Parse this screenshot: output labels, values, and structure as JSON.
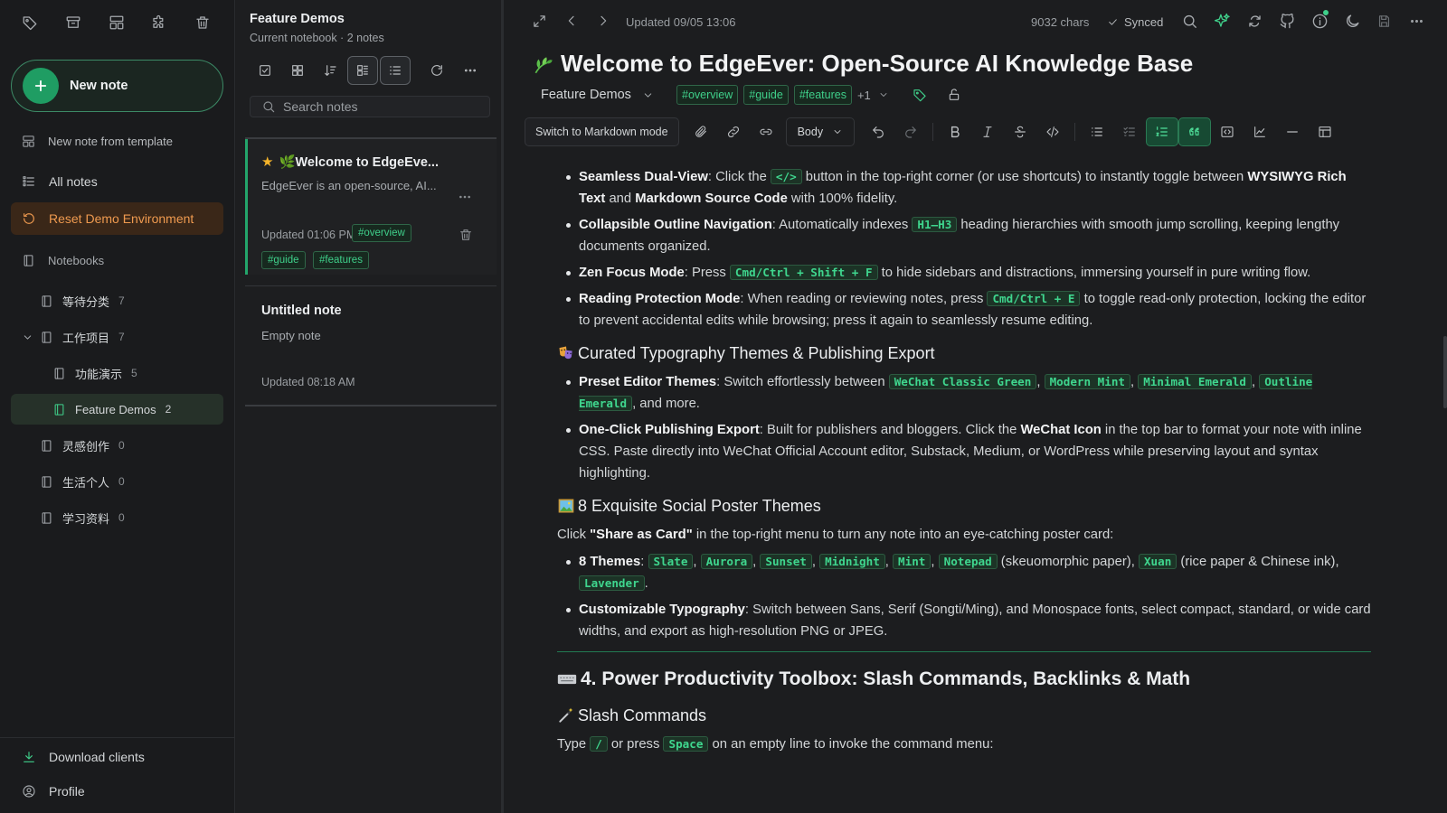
{
  "sidebar": {
    "new_note": "New note",
    "new_from_template": "New note from template",
    "all_notes": "All notes",
    "reset_demo": "Reset Demo Environment",
    "notebooks_label": "Notebooks",
    "notebooks": [
      {
        "name": "等待分类",
        "count": "7"
      },
      {
        "name": "工作项目",
        "count": "7"
      },
      {
        "name": "功能演示",
        "count": "5"
      },
      {
        "name": "Feature Demos",
        "count": "2"
      },
      {
        "name": "灵感创作",
        "count": "0"
      },
      {
        "name": "生活个人",
        "count": "0"
      },
      {
        "name": "学习资料",
        "count": "0"
      }
    ],
    "download_clients": "Download clients",
    "profile": "Profile"
  },
  "notelist": {
    "title": "Feature Demos",
    "subtitle": "Current notebook · 2 notes",
    "search_placeholder": "Search notes",
    "notes": [
      {
        "title": "🌿Welcome to EdgeEve...",
        "snippet": "EdgeEver is an open-source, AI...",
        "updated": "Updated 01:06 PM",
        "tags": [
          "#overview",
          "#guide",
          "#features"
        ],
        "starred": true
      },
      {
        "title": "Untitled note",
        "snippet": "Empty note",
        "updated": "Updated 08:18 AM",
        "tags": [],
        "starred": false
      }
    ]
  },
  "editor": {
    "updated": "Updated 09/05 13:06",
    "chars": "9032 chars",
    "synced": "Synced",
    "title": "Welcome to EdgeEver: Open-Source AI Knowledge Base",
    "notebook": "Feature Demos",
    "tags": [
      "#overview",
      "#guide",
      "#features"
    ],
    "tags_more": "+1",
    "markdown_mode": "Switch to Markdown mode",
    "text_style": "Body"
  },
  "content": {
    "b1_label": "Seamless Dual-View",
    "b1_a": ": Click the ",
    "b1_code": "</>",
    "b1_b": " button in the top-right corner (or use shortcuts) to instantly toggle between ",
    "b1_bold1": "WYSIWYG Rich Text",
    "b1_c": " and ",
    "b1_bold2": "Markdown Source Code",
    "b1_d": " with 100% fidelity.",
    "b2_label": "Collapsible Outline Navigation",
    "b2_a": ": Automatically indexes ",
    "b2_code": "H1–H3",
    "b2_b": " heading hierarchies with smooth jump scrolling, keeping lengthy documents organized.",
    "b3_label": "Zen Focus Mode",
    "b3_a": ": Press ",
    "b3_code": "Cmd/Ctrl + Shift + F",
    "b3_b": " to hide sidebars and distractions, immersing yourself in pure writing flow.",
    "b4_label": "Reading Protection Mode",
    "b4_a": ": When reading or reviewing notes, press ",
    "b4_code": "Cmd/Ctrl + E",
    "b4_b": " to toggle read-only protection, locking the editor to prevent accidental edits while browsing; press it again to seamlessly resume editing.",
    "h_typo": "Curated Typography Themes & Publishing Export",
    "t1_label": "Preset Editor Themes",
    "t1_a": ": Switch effortlessly between ",
    "t1_c1": "WeChat Classic Green",
    "t1_c2": "Modern Mint",
    "t1_c3": "Minimal Emerald",
    "t1_c4": "Outline Emerald",
    "t1_b": ", and more.",
    "t2_label": "One-Click Publishing Export",
    "t2_a": ": Built for publishers and bloggers. Click the ",
    "t2_bold": "WeChat Icon",
    "t2_b": " in the top bar to format your note with inline CSS. Paste directly into WeChat Official Account editor, Substack, Medium, or WordPress while preserving layout and syntax highlighting.",
    "h_poster": "8 Exquisite Social Poster Themes",
    "p_click": "Click ",
    "p_bold": "\"Share as Card\"",
    "p_rest": " in the top-right menu to turn any note into an eye-catching poster card:",
    "s1_label": "8 Themes",
    "s1_themes": [
      "Slate",
      "Aurora",
      "Sunset",
      "Midnight",
      "Mint",
      "Notepad"
    ],
    "s1_skeu": " (skeuomorphic paper), ",
    "s1_xuan": "Xuan",
    "s1_rice": " (rice paper & Chinese ink), ",
    "s1_lav": "Lavender",
    "s2_label": "Customizable Typography",
    "s2_a": ": Switch between Sans, Serif (Songti/Ming), and Monospace fonts, select compact, standard, or wide card widths, and export as high-resolution PNG or JPEG.",
    "h_power": "4. Power Productivity Toolbox: Slash Commands, Backlinks & Math",
    "h_slash": "Slash Commands",
    "sl_a": "Type ",
    "sl_c1": "/",
    "sl_b": " or press ",
    "sl_c2": "Space",
    "sl_c": " on an empty line to invoke the command menu:"
  },
  "colors": {
    "accent": "#23a56b",
    "accent_text": "#3fcf8a",
    "reset_bg": "#3a2718",
    "reset_text": "#ef9a4f",
    "background": "#1c1d1f"
  },
  "icons": [
    "tag-icon",
    "archive-icon",
    "template-icon",
    "puzzle-icon",
    "trash-icon",
    "plus-icon",
    "list-icon",
    "refresh-icon",
    "book-icon",
    "download-icon",
    "profile-icon",
    "search-icon",
    "expand-icon",
    "chevron-left-icon",
    "chevron-right-icon",
    "check-icon",
    "sparkles-icon",
    "recycle-icon",
    "github-icon",
    "info-icon",
    "moon-icon",
    "save-icon",
    "more-icon",
    "lock-icon",
    "attach-icon",
    "link-icon",
    "undo-icon",
    "redo-icon",
    "bold-icon",
    "italic-icon",
    "strike-icon",
    "code-icon",
    "bullet-list-icon",
    "task-list-icon",
    "ordered-list-icon",
    "quote-icon",
    "code-block-icon",
    "chart-icon",
    "hr-icon",
    "table-icon"
  ]
}
